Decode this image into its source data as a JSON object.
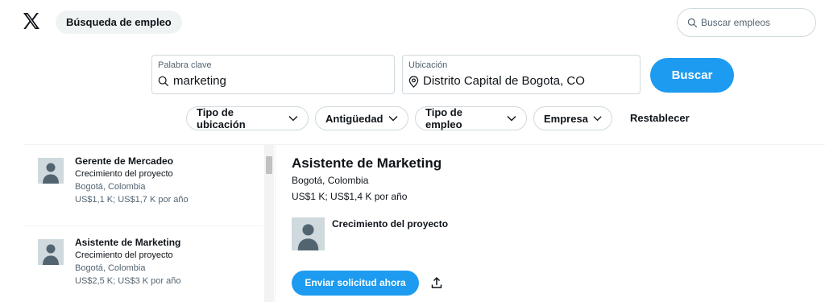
{
  "header": {
    "logo_icon": "x-logo-icon",
    "nav_pill": "Búsqueda de empleo",
    "search_placeholder": "Buscar empleos"
  },
  "search": {
    "keyword_label": "Palabra clave",
    "keyword_value": "marketing",
    "location_label": "Ubicación",
    "location_value": "Distrito Capital de Bogota, CO",
    "button": "Buscar"
  },
  "filters": {
    "items": [
      "Tipo de ubicación",
      "Antigüedad",
      "Tipo de empleo",
      "Empresa"
    ],
    "reset": "Restablecer"
  },
  "jobs": [
    {
      "title": "Gerente de Mercadeo",
      "company": "Crecimiento del proyecto",
      "location": "Bogotá, Colombia",
      "salary": "US$1,1 K; US$1,7 K por año"
    },
    {
      "title": "Asistente de Marketing",
      "company": "Crecimiento del proyecto",
      "location": "Bogotá, Colombia",
      "salary": "US$2,5 K; US$3 K por año"
    }
  ],
  "detail": {
    "title": "Asistente de Marketing",
    "location": "Bogotá, Colombia",
    "salary": "US$1 K; US$1,4 K por año",
    "company": "Crecimiento del proyecto",
    "apply_button": "Enviar solicitud ahora"
  },
  "colors": {
    "accent": "#1d9bf0",
    "border": "#cfd9de",
    "muted_text": "#536471"
  }
}
